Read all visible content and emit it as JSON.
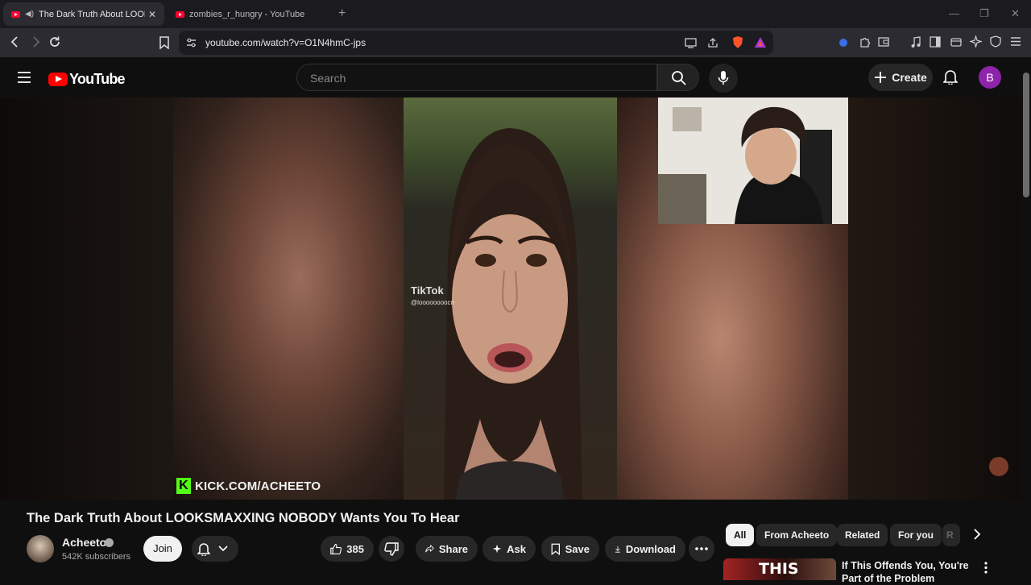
{
  "browser": {
    "tabs": [
      {
        "title": "The Dark Truth About LOOKSM",
        "active": true
      },
      {
        "title": "zombies_r_hungry - YouTube",
        "active": false
      }
    ],
    "url": "youtube.com/watch?v=O1N4hmC-jps"
  },
  "youtube": {
    "logo_text": "YouTube",
    "search_placeholder": "Search",
    "create_label": "Create",
    "avatar_letter": "B"
  },
  "player": {
    "watermark": "KICK.COM/ACHEETO",
    "tiktok_label": "TikTok",
    "tiktok_handle": "@loooooooocn"
  },
  "video": {
    "title": "The Dark Truth About LOOKSMAXXING NOBODY Wants You To Hear",
    "channel": "Acheeto",
    "subscribers": "542K subscribers",
    "join_label": "Join",
    "likes": "385",
    "share_label": "Share",
    "ask_label": "Ask",
    "save_label": "Save",
    "download_label": "Download"
  },
  "sidebar": {
    "chips": [
      "All",
      "From Acheeto",
      "Related",
      "For you",
      "R"
    ],
    "recommended": [
      {
        "thumb_text": "THIS",
        "title": "If This Offends You, You're Part of the Problem"
      }
    ]
  },
  "colors": {
    "brand": "#ff0000",
    "avatar": "#8e24aa",
    "kick": "#53fc18"
  }
}
